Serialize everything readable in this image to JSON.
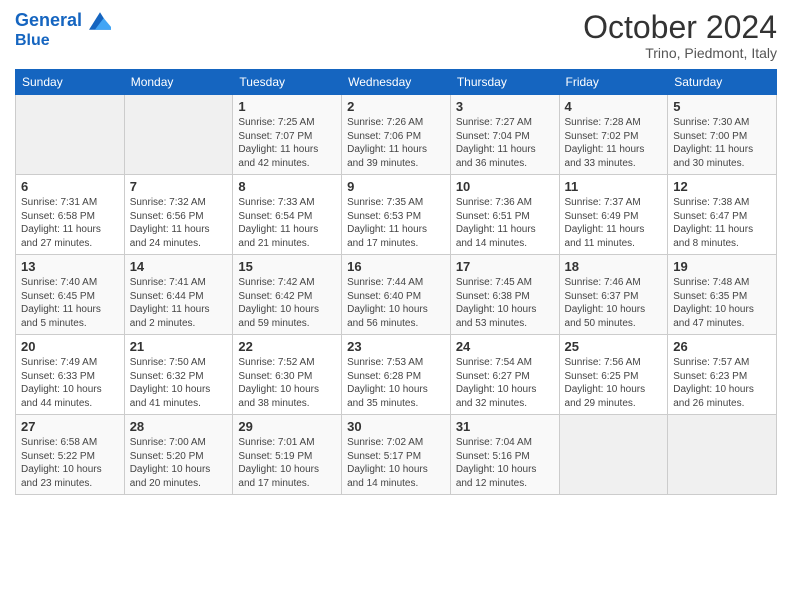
{
  "header": {
    "logo_line1": "General",
    "logo_line2": "Blue",
    "month": "October 2024",
    "location": "Trino, Piedmont, Italy"
  },
  "days_of_week": [
    "Sunday",
    "Monday",
    "Tuesday",
    "Wednesday",
    "Thursday",
    "Friday",
    "Saturday"
  ],
  "weeks": [
    [
      {
        "day": "",
        "info": ""
      },
      {
        "day": "",
        "info": ""
      },
      {
        "day": "1",
        "info": "Sunrise: 7:25 AM\nSunset: 7:07 PM\nDaylight: 11 hours and 42 minutes."
      },
      {
        "day": "2",
        "info": "Sunrise: 7:26 AM\nSunset: 7:06 PM\nDaylight: 11 hours and 39 minutes."
      },
      {
        "day": "3",
        "info": "Sunrise: 7:27 AM\nSunset: 7:04 PM\nDaylight: 11 hours and 36 minutes."
      },
      {
        "day": "4",
        "info": "Sunrise: 7:28 AM\nSunset: 7:02 PM\nDaylight: 11 hours and 33 minutes."
      },
      {
        "day": "5",
        "info": "Sunrise: 7:30 AM\nSunset: 7:00 PM\nDaylight: 11 hours and 30 minutes."
      }
    ],
    [
      {
        "day": "6",
        "info": "Sunrise: 7:31 AM\nSunset: 6:58 PM\nDaylight: 11 hours and 27 minutes."
      },
      {
        "day": "7",
        "info": "Sunrise: 7:32 AM\nSunset: 6:56 PM\nDaylight: 11 hours and 24 minutes."
      },
      {
        "day": "8",
        "info": "Sunrise: 7:33 AM\nSunset: 6:54 PM\nDaylight: 11 hours and 21 minutes."
      },
      {
        "day": "9",
        "info": "Sunrise: 7:35 AM\nSunset: 6:53 PM\nDaylight: 11 hours and 17 minutes."
      },
      {
        "day": "10",
        "info": "Sunrise: 7:36 AM\nSunset: 6:51 PM\nDaylight: 11 hours and 14 minutes."
      },
      {
        "day": "11",
        "info": "Sunrise: 7:37 AM\nSunset: 6:49 PM\nDaylight: 11 hours and 11 minutes."
      },
      {
        "day": "12",
        "info": "Sunrise: 7:38 AM\nSunset: 6:47 PM\nDaylight: 11 hours and 8 minutes."
      }
    ],
    [
      {
        "day": "13",
        "info": "Sunrise: 7:40 AM\nSunset: 6:45 PM\nDaylight: 11 hours and 5 minutes."
      },
      {
        "day": "14",
        "info": "Sunrise: 7:41 AM\nSunset: 6:44 PM\nDaylight: 11 hours and 2 minutes."
      },
      {
        "day": "15",
        "info": "Sunrise: 7:42 AM\nSunset: 6:42 PM\nDaylight: 10 hours and 59 minutes."
      },
      {
        "day": "16",
        "info": "Sunrise: 7:44 AM\nSunset: 6:40 PM\nDaylight: 10 hours and 56 minutes."
      },
      {
        "day": "17",
        "info": "Sunrise: 7:45 AM\nSunset: 6:38 PM\nDaylight: 10 hours and 53 minutes."
      },
      {
        "day": "18",
        "info": "Sunrise: 7:46 AM\nSunset: 6:37 PM\nDaylight: 10 hours and 50 minutes."
      },
      {
        "day": "19",
        "info": "Sunrise: 7:48 AM\nSunset: 6:35 PM\nDaylight: 10 hours and 47 minutes."
      }
    ],
    [
      {
        "day": "20",
        "info": "Sunrise: 7:49 AM\nSunset: 6:33 PM\nDaylight: 10 hours and 44 minutes."
      },
      {
        "day": "21",
        "info": "Sunrise: 7:50 AM\nSunset: 6:32 PM\nDaylight: 10 hours and 41 minutes."
      },
      {
        "day": "22",
        "info": "Sunrise: 7:52 AM\nSunset: 6:30 PM\nDaylight: 10 hours and 38 minutes."
      },
      {
        "day": "23",
        "info": "Sunrise: 7:53 AM\nSunset: 6:28 PM\nDaylight: 10 hours and 35 minutes."
      },
      {
        "day": "24",
        "info": "Sunrise: 7:54 AM\nSunset: 6:27 PM\nDaylight: 10 hours and 32 minutes."
      },
      {
        "day": "25",
        "info": "Sunrise: 7:56 AM\nSunset: 6:25 PM\nDaylight: 10 hours and 29 minutes."
      },
      {
        "day": "26",
        "info": "Sunrise: 7:57 AM\nSunset: 6:23 PM\nDaylight: 10 hours and 26 minutes."
      }
    ],
    [
      {
        "day": "27",
        "info": "Sunrise: 6:58 AM\nSunset: 5:22 PM\nDaylight: 10 hours and 23 minutes."
      },
      {
        "day": "28",
        "info": "Sunrise: 7:00 AM\nSunset: 5:20 PM\nDaylight: 10 hours and 20 minutes."
      },
      {
        "day": "29",
        "info": "Sunrise: 7:01 AM\nSunset: 5:19 PM\nDaylight: 10 hours and 17 minutes."
      },
      {
        "day": "30",
        "info": "Sunrise: 7:02 AM\nSunset: 5:17 PM\nDaylight: 10 hours and 14 minutes."
      },
      {
        "day": "31",
        "info": "Sunrise: 7:04 AM\nSunset: 5:16 PM\nDaylight: 10 hours and 12 minutes."
      },
      {
        "day": "",
        "info": ""
      },
      {
        "day": "",
        "info": ""
      }
    ]
  ]
}
